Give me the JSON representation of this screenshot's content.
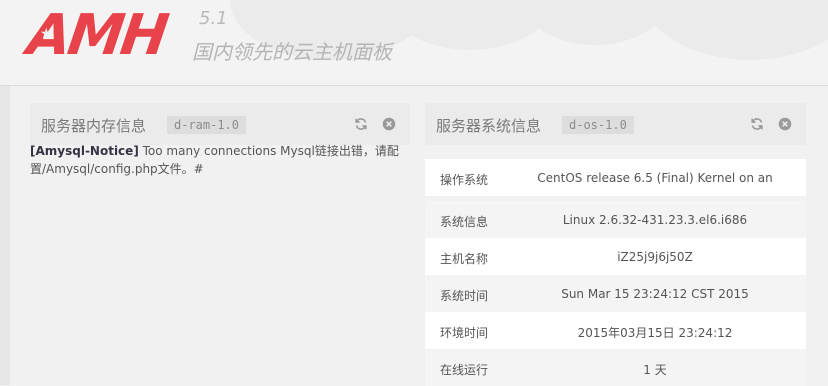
{
  "header": {
    "logo_text": "AMH",
    "version": "5.1",
    "slogan": "国内领先的云主机面板"
  },
  "panels": {
    "memory": {
      "title": "服务器内存信息",
      "tag": "d-ram-1.0",
      "notice_strong": "[Amysql-Notice]",
      "notice_text": "Too many connections Mysql链接出错，请配置/Amysql/config.php文件。#"
    },
    "system": {
      "title": "服务器系统信息",
      "tag": "d-os-1.0",
      "rows": [
        {
          "label": "操作系统",
          "value": "CentOS release 6.5 (Final) Kernel on an"
        },
        {
          "label": "系统信息",
          "value": "Linux 2.6.32-431.23.3.el6.i686"
        },
        {
          "label": "主机名称",
          "value": "iZ25j9j6j50Z"
        },
        {
          "label": "系统时间",
          "value": "Sun Mar 15 23:24:12 CST 2015"
        },
        {
          "label": "环境时间",
          "value": "2015年03月15日 23:24:12"
        },
        {
          "label": "在线运行",
          "value": "1 天"
        }
      ]
    }
  },
  "icons": {
    "refresh": "refresh-icon",
    "close": "close-icon"
  },
  "colors": {
    "brand": "#e8434a",
    "panel_head": "#ebebeb",
    "tag_bg": "#dddddd"
  }
}
